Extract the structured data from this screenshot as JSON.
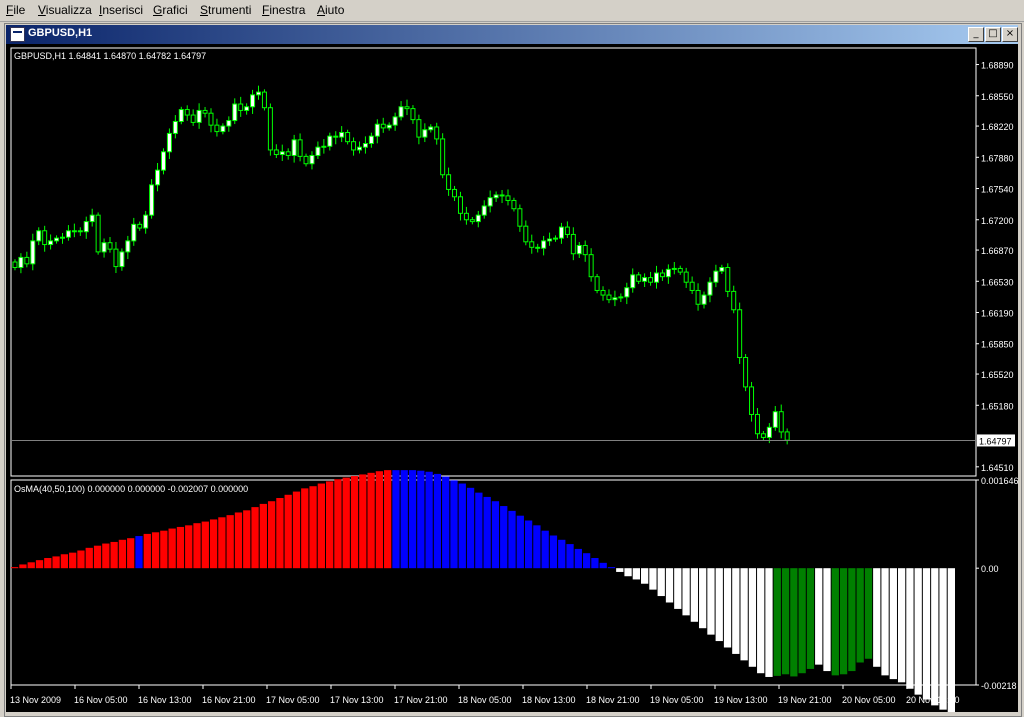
{
  "menu": {
    "items": [
      {
        "label": "File",
        "u": "F",
        "rest": "ile"
      },
      {
        "label": "Visualizza",
        "u": "V",
        "rest": "isualizza"
      },
      {
        "label": "Inserisci",
        "u": "I",
        "rest": "nserisci"
      },
      {
        "label": "Grafici",
        "u": "G",
        "rest": "rafici"
      },
      {
        "label": "Strumenti",
        "u": "S",
        "rest": "trumenti"
      },
      {
        "label": "Finestra",
        "u": "F",
        "rest": "inestra"
      },
      {
        "label": "Aiuto",
        "u": "A",
        "rest": "iuto"
      }
    ]
  },
  "window": {
    "title": "GBPUSD,H1",
    "minimize": "_",
    "maximize": "□",
    "close": "×"
  },
  "colors": {
    "background": "#000000",
    "grid_text": "#ffffff",
    "bull_candle": "#ffffff",
    "wick": "#00ff00",
    "hist_rising_pos": "#ff0000",
    "hist_falling_pos": "#0000ff",
    "hist_falling_neg": "#ffffff",
    "hist_rising_neg": "#008000",
    "price_line": "#808080"
  },
  "chart_data": [
    {
      "type": "candlestick",
      "title": "GBPUSD,H1",
      "ohlc_text": "1.64841 1.64870 1.64782 1.64797",
      "current_price": "1.64797",
      "y_ticks": [
        "1.68890",
        "1.68550",
        "1.68220",
        "1.67880",
        "1.67540",
        "1.67200",
        "1.66870",
        "1.66530",
        "1.66190",
        "1.65850",
        "1.65520",
        "1.65180",
        "1.64510"
      ],
      "ylim": [
        1.6441,
        1.6907
      ],
      "x_ticks": [
        "13 Nov 2009",
        "16 Nov 05:00",
        "16 Nov 13:00",
        "16 Nov 21:00",
        "17 Nov 05:00",
        "17 Nov 13:00",
        "17 Nov 21:00",
        "18 Nov 05:00",
        "18 Nov 13:00",
        "18 Nov 21:00",
        "19 Nov 05:00",
        "19 Nov 13:00",
        "19 Nov 21:00",
        "20 Nov 05:00",
        "20 Nov 13:00"
      ],
      "close": [
        1.6668,
        1.6679,
        1.6672,
        1.6697,
        1.6708,
        1.6693,
        1.6697,
        1.67,
        1.6701,
        1.6708,
        1.6708,
        1.6707,
        1.6718,
        1.6725,
        1.6685,
        1.6695,
        1.6688,
        1.6669,
        1.6685,
        1.6697,
        1.6715,
        1.6711,
        1.6725,
        1.6758,
        1.6774,
        1.6794,
        1.6814,
        1.6827,
        1.684,
        1.6834,
        1.6826,
        1.6839,
        1.6836,
        1.6823,
        1.6816,
        1.6822,
        1.6828,
        1.6846,
        1.6839,
        1.6843,
        1.6856,
        1.6859,
        1.6842,
        1.6796,
        1.6791,
        1.6794,
        1.679,
        1.6807,
        1.6789,
        1.6781,
        1.679,
        1.6799,
        1.68,
        1.6811,
        1.681,
        1.6815,
        1.6805,
        1.6796,
        1.6799,
        1.6803,
        1.6811,
        1.6824,
        1.682,
        1.6823,
        1.6832,
        1.6843,
        1.6841,
        1.6829,
        1.681,
        1.6818,
        1.6821,
        1.6808,
        1.6769,
        1.6753,
        1.6745,
        1.6727,
        1.672,
        1.6718,
        1.6725,
        1.6735,
        1.6744,
        1.6747,
        1.6746,
        1.6741,
        1.6732,
        1.6713,
        1.6696,
        1.669,
        1.6689,
        1.6697,
        1.6699,
        1.67,
        1.6712,
        1.6704,
        1.6683,
        1.6692,
        1.6682,
        1.6658,
        1.6643,
        1.6638,
        1.6633,
        1.6635,
        1.6636,
        1.6646,
        1.666,
        1.6653,
        1.6657,
        1.6652,
        1.6662,
        1.6658,
        1.6666,
        1.6667,
        1.6663,
        1.6652,
        1.6643,
        1.6628,
        1.6638,
        1.6652,
        1.6664,
        1.6668,
        1.6642,
        1.6622,
        1.657,
        1.6538,
        1.6508,
        1.6487,
        1.6483,
        1.6494,
        1.6511,
        1.6489,
        1.648
      ],
      "x_range": "13 Nov 2009 – 20 Nov 13:00"
    },
    {
      "type": "bar",
      "title": "OsMA(40,50,100)",
      "values_text": "0.000000 0.000000 -0.002007 0.000000",
      "y_ticks": [
        "0.001646",
        "0.00",
        "-0.00218"
      ],
      "ylim": [
        -0.00218,
        0.001646
      ],
      "values": [
        2e-05,
        7e-05,
        0.00011,
        0.00015,
        0.00019,
        0.00022,
        0.00026,
        0.00029,
        0.00033,
        0.00038,
        0.00042,
        0.00046,
        0.00049,
        0.00053,
        0.00056,
        0.0006,
        0.00064,
        0.00067,
        0.0007,
        0.00074,
        0.00077,
        0.0008,
        0.00084,
        0.00087,
        0.00091,
        0.00095,
        0.00099,
        0.00104,
        0.00108,
        0.00114,
        0.0012,
        0.00125,
        0.00131,
        0.00137,
        0.00143,
        0.00149,
        0.00153,
        0.00158,
        0.00162,
        0.00166,
        0.00169,
        0.00172,
        0.00175,
        0.00178,
        0.00181,
        0.00183,
        0.00183,
        0.00183,
        0.00183,
        0.00182,
        0.0018,
        0.00176,
        0.00171,
        0.00164,
        0.00158,
        0.0015,
        0.00141,
        0.00133,
        0.00125,
        0.00116,
        0.00107,
        0.00098,
        0.00089,
        0.0008,
        0.0007,
        0.00061,
        0.00053,
        0.00045,
        0.00036,
        0.00028,
        0.00019,
        0.0001,
        2e-05,
        -7e-05,
        -0.00015,
        -0.00021,
        -0.00029,
        -0.0004,
        -0.00052,
        -0.00064,
        -0.00076,
        -0.00088,
        -0.001,
        -0.00112,
        -0.00124,
        -0.00136,
        -0.00148,
        -0.0016,
        -0.00172,
        -0.00184,
        -0.00196,
        -0.00203,
        -0.00201,
        -0.00198,
        -0.00202,
        -0.00196,
        -0.00188,
        -0.0018,
        -0.00192,
        -0.002,
        -0.00198,
        -0.00192,
        -0.00176,
        -0.00169,
        -0.00184,
        -0.002,
        -0.00207,
        -0.00213,
        -0.00225,
        -0.00236,
        -0.00245,
        -0.00256,
        -0.00264,
        -0.00271
      ],
      "color_codes": [
        "rise",
        "rise",
        "rise",
        "rise",
        "rise",
        "rise",
        "rise",
        "rise",
        "rise",
        "rise",
        "rise",
        "rise",
        "rise",
        "rise",
        "rise",
        "fall",
        "rise",
        "rise",
        "rise",
        "rise",
        "rise",
        "rise",
        "rise",
        "rise",
        "rise",
        "rise",
        "rise",
        "rise",
        "rise",
        "rise",
        "rise",
        "rise",
        "rise",
        "rise",
        "rise",
        "rise",
        "rise",
        "rise",
        "rise",
        "rise",
        "rise",
        "rise",
        "rise",
        "rise",
        "rise",
        "rise",
        "fall",
        "fall",
        "fall",
        "fall",
        "fall",
        "fall",
        "fall",
        "fall",
        "fall",
        "fall",
        "fall",
        "fall",
        "fall",
        "fall",
        "fall",
        "fall",
        "fall",
        "fall",
        "fall",
        "fall",
        "fall",
        "fall",
        "fall",
        "fall",
        "fall",
        "fall",
        "fall",
        "neg",
        "neg",
        "neg",
        "neg",
        "neg",
        "neg",
        "neg",
        "neg",
        "neg",
        "neg",
        "neg",
        "neg",
        "neg",
        "neg",
        "neg",
        "neg",
        "neg",
        "neg",
        "neg",
        "green",
        "green",
        "green",
        "green",
        "green",
        "neg",
        "neg",
        "green",
        "green",
        "green",
        "green",
        "green",
        "neg",
        "neg",
        "neg",
        "neg",
        "neg",
        "neg",
        "neg",
        "neg",
        "neg",
        "neg"
      ]
    }
  ]
}
